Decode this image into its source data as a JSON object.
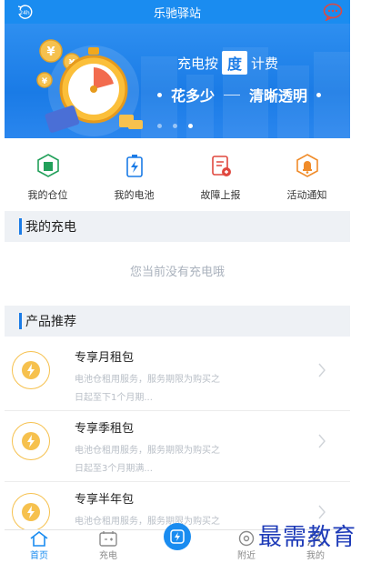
{
  "header": {
    "title": "乐驰驿站",
    "left_icon": "clock-24h-icon",
    "right_icon": "chat-bubble-icon"
  },
  "banner": {
    "prefix": "充电按",
    "highlight": "度",
    "suffix": "计费",
    "slogan1": "花多少",
    "slogan2": "清晰透明",
    "pages": 3,
    "active_page": 2
  },
  "quick_actions": [
    {
      "label": "我的仓位",
      "icon": "warehouse-icon",
      "color": "#22a05a"
    },
    {
      "label": "我的电池",
      "icon": "battery-icon",
      "color": "#1a7be6"
    },
    {
      "label": "故障上报",
      "icon": "fault-report-icon",
      "color": "#e0483f"
    },
    {
      "label": "活动通知",
      "icon": "bell-notice-icon",
      "color": "#f08c2a"
    }
  ],
  "charging": {
    "section_title": "我的充电",
    "empty_text": "您当前没有充电哦"
  },
  "products": {
    "section_title": "产品推荐",
    "items": [
      {
        "name": "专享月租包",
        "desc_line1": "电池仓租用服务，服务期限为购买之",
        "desc_line2": "日起至下1个月期..."
      },
      {
        "name": "专享季租包",
        "desc_line1": "电池仓租用服务，服务期限为购买之",
        "desc_line2": "日起至3个月期满..."
      },
      {
        "name": "专享半年包",
        "desc_line1": "电池仓租用服务，服务期限为购买之",
        "desc_line2": ""
      }
    ]
  },
  "tabbar": {
    "tabs": [
      {
        "label": "首页",
        "icon": "home-icon",
        "active": true
      },
      {
        "label": "充电",
        "icon": "charge-icon",
        "active": false
      },
      {
        "label": "",
        "icon": "scan-charge-icon",
        "active": false
      },
      {
        "label": "附近",
        "icon": "location-icon",
        "active": false
      },
      {
        "label": "我的",
        "icon": "profile-icon",
        "active": false
      }
    ]
  },
  "watermark": "最需教育",
  "colors": {
    "brand": "#1a8cf0",
    "accent_orange": "#f6c14e",
    "section_bg": "#eef1f5"
  }
}
